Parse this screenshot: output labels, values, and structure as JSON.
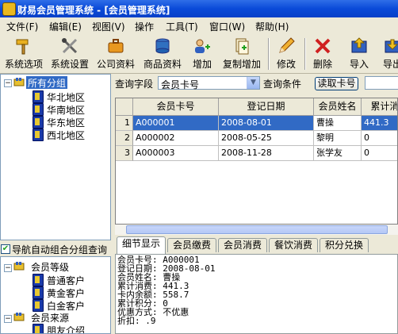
{
  "window": {
    "title": "财易会员管理系统 - [会员管理系统]"
  },
  "menu": [
    "文件(F)",
    "编辑(E)",
    "视图(V)",
    "操作",
    "工具(T)",
    "窗口(W)",
    "帮助(H)"
  ],
  "toolbar": [
    {
      "label": "系统选项",
      "icon": "hammer-icon"
    },
    {
      "label": "系统设置",
      "icon": "tools-icon"
    },
    {
      "label": "公司资料",
      "icon": "briefcase-icon"
    },
    {
      "label": "商品资料",
      "icon": "database-icon"
    },
    {
      "label": "增加",
      "icon": "add-user-icon"
    },
    {
      "label": "复制增加",
      "icon": "copy-add-icon"
    },
    {
      "label": "修改",
      "icon": "pencil-icon"
    },
    {
      "label": "删除",
      "icon": "delete-x-icon"
    },
    {
      "label": "导入",
      "icon": "import-icon"
    },
    {
      "label": "导出",
      "icon": "export-icon"
    }
  ],
  "tree": {
    "root": "所有分组",
    "children": [
      "华北地区",
      "华南地区",
      "华东地区",
      "西北地区"
    ]
  },
  "nav_checkbox": {
    "label": "导航自动组合分组查询",
    "checked": true
  },
  "tree2": {
    "groups": [
      {
        "label": "会员等级",
        "children": [
          "普通客户",
          "黄金客户",
          "白金客户"
        ]
      },
      {
        "label": "会员来源",
        "children": [
          "朋友介绍"
        ]
      }
    ]
  },
  "search": {
    "field_label": "查询字段",
    "field_value": "会员卡号",
    "condition_label": "查询条件",
    "read_card_button": "读取卡号"
  },
  "grid": {
    "columns": [
      "会员卡号",
      "登记日期",
      "会员姓名",
      "累计消"
    ],
    "rows": [
      {
        "n": "1",
        "card": "A000001",
        "date": "2008-08-01",
        "name": "曹操",
        "total": "441.3",
        "selected": true
      },
      {
        "n": "2",
        "card": "A000002",
        "date": "2008-05-25",
        "name": "黎明",
        "total": "0",
        "selected": false
      },
      {
        "n": "3",
        "card": "A000003",
        "date": "2008-11-28",
        "name": "张学友",
        "total": "0",
        "selected": false
      }
    ]
  },
  "tabs": [
    "细节显示",
    "会员缴费",
    "会员消费",
    "餐饮消费",
    "积分兑换"
  ],
  "detail": [
    "会员卡号: A000001",
    "登记日期: 2008-08-01",
    "会员姓名: 曹操",
    "累计消费: 441.3",
    "卡内余额: 558.7",
    "累计积分: 0",
    "优惠方式: 不优惠",
    "折扣:    .9"
  ],
  "colors": {
    "titlebar": "#0a4ad8",
    "selection": "#316ac5",
    "chrome": "#ece9d8"
  }
}
